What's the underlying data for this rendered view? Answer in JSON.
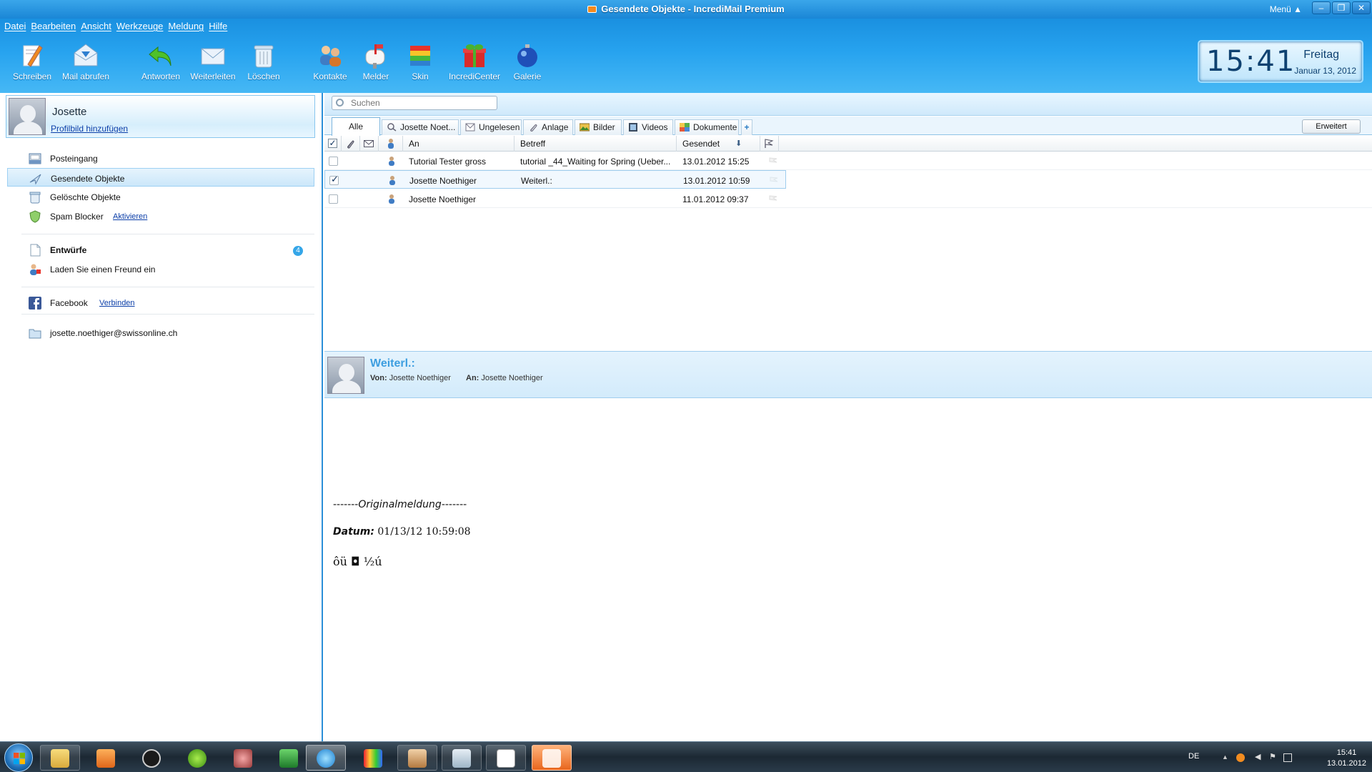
{
  "window": {
    "title": "Gesendete Objekte - IncrediMail Premium",
    "menu_label": "Menü",
    "min_glyph": "–",
    "max_glyph": "❐",
    "close_glyph": "✕"
  },
  "menubar": [
    "Datei",
    "Bearbeiten",
    "Ansicht",
    "Werkzeuge",
    "Meldung",
    "Hilfe"
  ],
  "toolbar": [
    {
      "label": "Schreiben",
      "icon": "compose-icon"
    },
    {
      "label": "Mail abrufen",
      "icon": "get-mail-icon"
    },
    {
      "label": "Antworten",
      "icon": "reply-icon"
    },
    {
      "label": "Weiterleiten",
      "icon": "forward-icon"
    },
    {
      "label": "Löschen",
      "icon": "trash-icon"
    },
    {
      "label": "Kontakte",
      "icon": "contacts-icon"
    },
    {
      "label": "Melder",
      "icon": "notifier-icon"
    },
    {
      "label": "Skin",
      "icon": "skin-icon"
    },
    {
      "label": "IncrediCenter",
      "icon": "gift-icon"
    },
    {
      "label": "Galerie",
      "icon": "gallery-icon"
    }
  ],
  "clock": {
    "time": "15:41",
    "day": "Freitag",
    "date": "Januar 13, 2012"
  },
  "profile": {
    "name": "Josette",
    "add_picture": "Profilbild hinzufügen"
  },
  "folders": {
    "inbox": "Posteingang",
    "sent": "Gesendete Objekte",
    "deleted": "Gelöschte Objekte",
    "spam": "Spam Blocker",
    "spam_action": "Aktivieren",
    "drafts": "Entwürfe",
    "drafts_count": "4",
    "invite": "Laden Sie einen Freund ein",
    "facebook": "Facebook",
    "facebook_action": "Verbinden",
    "account": "josette.noethiger@swissonline.ch"
  },
  "search": {
    "placeholder": "Suchen"
  },
  "tabs": [
    "Alle",
    "Josette Noet...",
    "Ungelesen",
    "Anlage",
    "Bilder",
    "Videos",
    "Dokumente"
  ],
  "tab_add": "+",
  "advanced_button": "Erweitert",
  "columns": {
    "to": "An",
    "subject": "Betreff",
    "sent": "Gesendet"
  },
  "messages": [
    {
      "to": "Tutorial Tester gross",
      "subject": "tutorial _44_Waiting for Spring (Ueber...",
      "sent": "13.01.2012 15:25",
      "checked": false,
      "selected": false
    },
    {
      "to": "Josette Noethiger",
      "subject": "Weiterl.:",
      "sent": "13.01.2012 10:59",
      "checked": true,
      "selected": true
    },
    {
      "to": "Josette Noethiger",
      "subject": "",
      "sent": "11.01.2012 09:37",
      "checked": false,
      "selected": false
    }
  ],
  "preview": {
    "subject": "Weiterl.:",
    "from_label": "Von:",
    "from": "Josette Noethiger",
    "to_label": "An:",
    "to": "Josette Noethiger",
    "body_dashes_left": "-------",
    "body_original": "Originalmeldung",
    "body_dashes_right": "-------",
    "body_date_label": "Datum",
    "body_date_sep": ":",
    "body_date": " 01/13/12 10:59:08",
    "body_garbled": "ôü ◘ ½ú"
  },
  "taskbar": {
    "lang": "DE",
    "time": "15:41",
    "date": "13.01.2012"
  }
}
